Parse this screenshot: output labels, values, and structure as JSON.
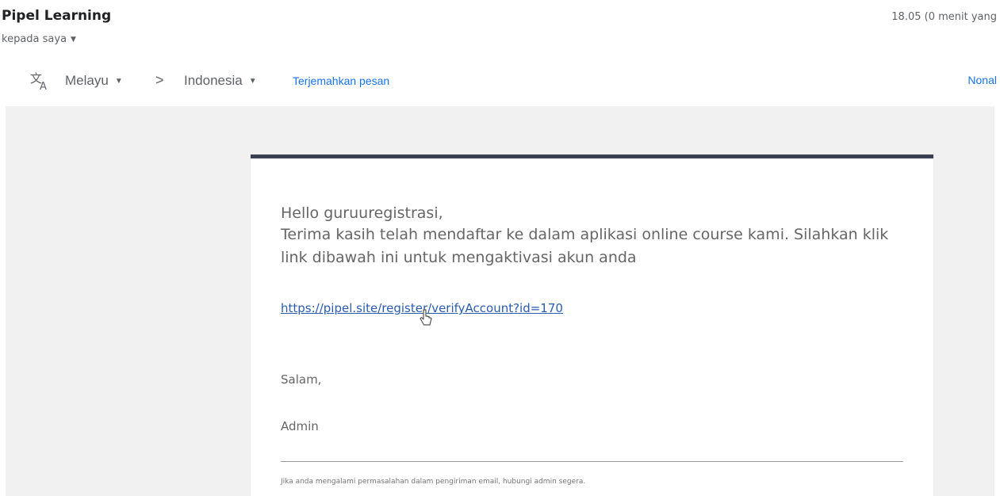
{
  "header": {
    "sender_name": "Pipel Learning",
    "recipient_label": "kepada saya",
    "timestamp": "18.05 (0 menit yang"
  },
  "translate_bar": {
    "icon": "translate-icon",
    "source_language": "Melayu",
    "arrow": ">",
    "target_language": "Indonesia",
    "translate_link": "Terjemahkan pesan",
    "disable_link": "Nonal"
  },
  "email": {
    "greeting": "Hello guruuregistrasi,",
    "message": "Terima kasih telah mendaftar ke dalam aplikasi online course kami. Silahkan klik link dibawah ini untuk mengaktivasi akun anda",
    "verify_link": "https://pipel.site/register/verifyAccount?id=170",
    "closing": "Salam,",
    "signature": "Admin",
    "footer_note": "Jika anda mengalami permasalahan dalam pengiriman email, hubungi admin segera."
  },
  "colors": {
    "card_top_border": "#3b3f52",
    "link": "#1a73e8",
    "body_background": "#f1f1f1"
  }
}
